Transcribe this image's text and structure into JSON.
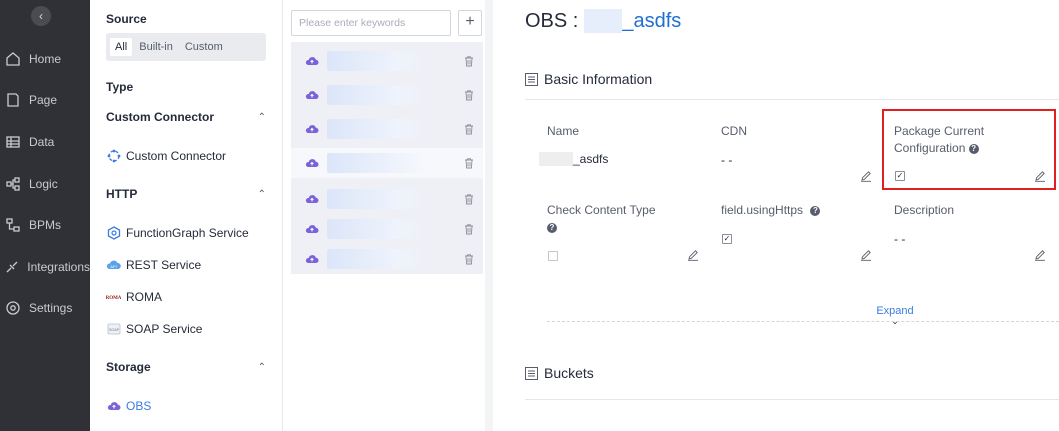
{
  "nav": {
    "items": [
      {
        "label": "Home",
        "icon": "home-icon"
      },
      {
        "label": "Page",
        "icon": "page-icon"
      },
      {
        "label": "Data",
        "icon": "data-icon"
      },
      {
        "label": "Logic",
        "icon": "logic-icon"
      },
      {
        "label": "BPMs",
        "icon": "bpm-icon"
      },
      {
        "label": "Integrations",
        "icon": "integrations-icon"
      },
      {
        "label": "Settings",
        "icon": "settings-icon"
      }
    ]
  },
  "catalog": {
    "source_title": "Source",
    "source_tabs": [
      "All",
      "Built-in",
      "Custom"
    ],
    "type_title": "Type",
    "groups": [
      {
        "title": "Custom Connector",
        "items": [
          "Custom Connector"
        ]
      },
      {
        "title": "HTTP",
        "items": [
          "FunctionGraph Service",
          "REST Service",
          "ROMA",
          "SOAP Service"
        ]
      },
      {
        "title": "Storage",
        "items": [
          "OBS"
        ]
      }
    ]
  },
  "list": {
    "search_placeholder": "Please enter keywords",
    "add_label": "+"
  },
  "detail": {
    "title_prefix": "OBS :",
    "title_name": "_asdfs",
    "basic_info_title": "Basic Information",
    "fields": {
      "name_label": "Name",
      "name_value": "_asdfs",
      "cdn_label": "CDN",
      "cdn_value": "- -",
      "package_label_line1": "Package Current",
      "package_label_line2": "Configuration",
      "check_content_type_label": "Check Content Type",
      "using_https_label": "field.usingHttps",
      "description_label": "Description",
      "description_value": "- -"
    },
    "expand_label": "Expand",
    "buckets_title": "Buckets"
  },
  "colors": {
    "accent": "#3a7ce0",
    "nav_bg": "#2f3136",
    "highlight_box": "#e02020"
  }
}
